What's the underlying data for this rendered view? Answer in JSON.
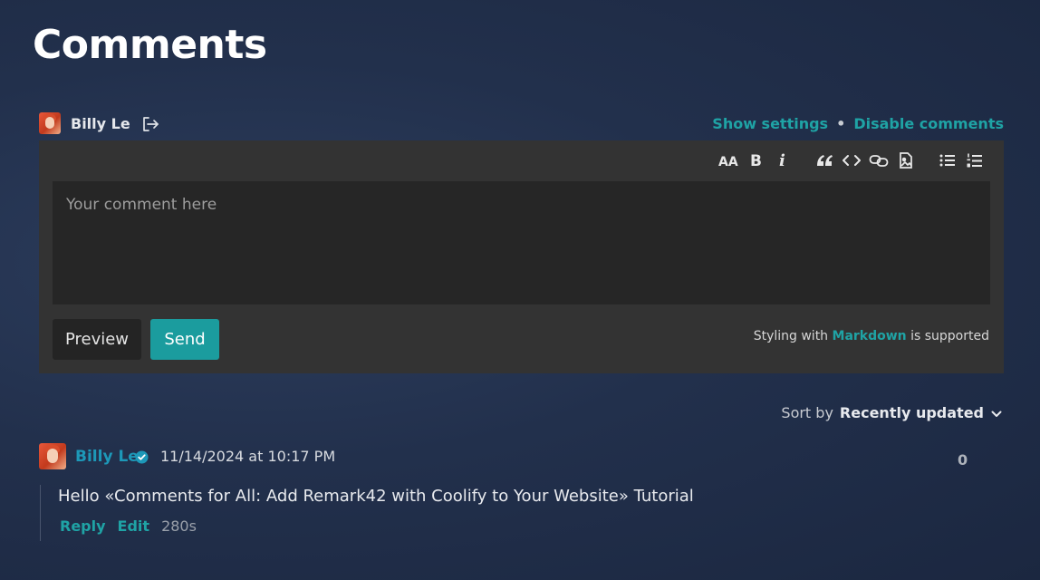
{
  "page": {
    "title": "Comments"
  },
  "auth": {
    "user_name": "Billy Le",
    "logout_icon": "logout-icon",
    "show_settings": "Show settings",
    "separator": "•",
    "disable_comments": "Disable comments"
  },
  "toolbar": {
    "icons": [
      "header-icon",
      "bold-icon",
      "italic-icon",
      "quote-icon",
      "code-icon",
      "link-icon",
      "image-icon",
      "unordered-list-icon",
      "ordered-list-icon"
    ],
    "header_glyph": "AA",
    "bold_glyph": "B",
    "italic_glyph": "i"
  },
  "editor": {
    "value": "",
    "placeholder": "Your comment here",
    "preview_label": "Preview",
    "send_label": "Send",
    "note_prefix": "Styling with",
    "note_link": "Markdown",
    "note_suffix": "is supported"
  },
  "sort": {
    "label": "Sort by",
    "value": "Recently updated"
  },
  "comment": {
    "author": "Billy Le",
    "timestamp": "11/14/2024 at 10:17 PM",
    "score": "0",
    "text": "Hello «Comments for All: Add Remark42 with Coolify to Your Website» Tutorial",
    "reply_label": "Reply",
    "edit_label": "Edit",
    "edit_timer": "280s"
  },
  "colors": {
    "accent": "#1fa3a5",
    "author_link": "#1d98b8",
    "send_button": "#1b9c9e",
    "editor_panel": "#333333",
    "textarea_bg": "#262626"
  }
}
